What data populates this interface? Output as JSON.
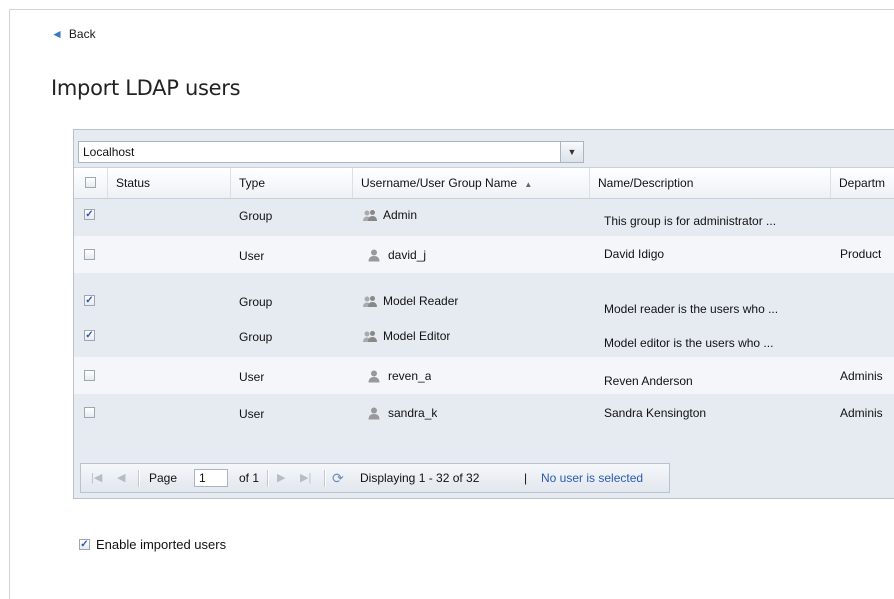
{
  "back_label": "Back",
  "page_title": "Import LDAP users",
  "server_select": {
    "value": "Localhost"
  },
  "columns": {
    "status": "Status",
    "type": "Type",
    "username": "Username/User Group Name",
    "name": "Name/Description",
    "department": "Departm"
  },
  "rows": [
    {
      "checked": true,
      "status": "",
      "type": "Group",
      "icon": "group-icon",
      "username": "Admin",
      "name": "This group is for administrator ...",
      "department": ""
    },
    {
      "checked": false,
      "status": "",
      "type": "User",
      "icon": "user-icon",
      "username": "david_j",
      "name": "David Idigo",
      "department": "Product"
    },
    {
      "checked": true,
      "status": "",
      "type": "Group",
      "icon": "group-icon",
      "username": "Model Reader",
      "name": "Model reader is the users who ...",
      "department": ""
    },
    {
      "checked": true,
      "status": "",
      "type": "Group",
      "icon": "group-icon",
      "username": "Model Editor",
      "name": "Model editor is the users who ...",
      "department": ""
    },
    {
      "checked": false,
      "status": "",
      "type": "User",
      "icon": "user-icon",
      "username": "reven_a",
      "name": "Reven Anderson",
      "department": "Adminis"
    },
    {
      "checked": false,
      "status": "",
      "type": "User",
      "icon": "user-icon",
      "username": "sandra_k",
      "name": "Sandra Kensington",
      "department": "Adminis"
    }
  ],
  "pager": {
    "page_label": "Page",
    "page_value": "1",
    "of_label": "of 1",
    "displaying": "Displaying 1 - 32 of 32",
    "divider": "|",
    "selection_status": "No user is selected"
  },
  "enable_imported": {
    "label": "Enable imported users",
    "checked": true
  },
  "colors": {
    "accent": "#2a5bb5",
    "panel": "#e6ebf2"
  }
}
